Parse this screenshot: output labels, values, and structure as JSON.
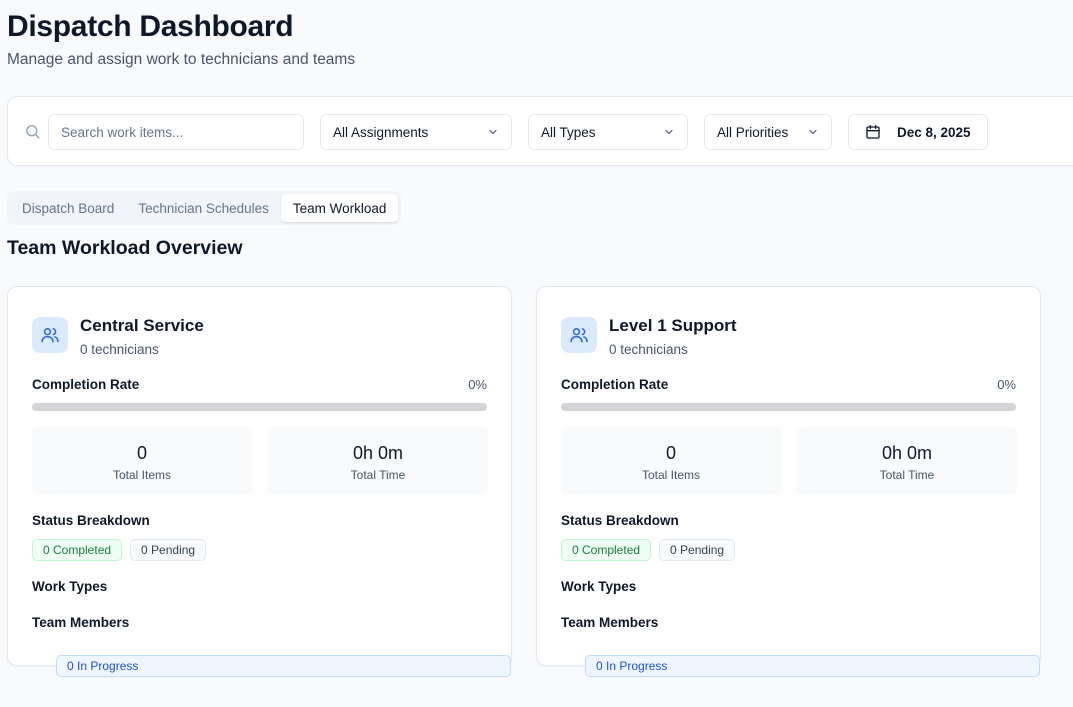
{
  "header": {
    "title": "Dispatch Dashboard",
    "subtitle": "Manage and assign work to technicians and teams"
  },
  "filters": {
    "search_placeholder": "Search work items...",
    "assignment": "All Assignments",
    "type": "All Types",
    "priority": "All Priorities",
    "date": "Dec 8, 2025"
  },
  "tabs": [
    {
      "label": "Dispatch Board",
      "active": false
    },
    {
      "label": "Technician Schedules",
      "active": false
    },
    {
      "label": "Team Workload",
      "active": true
    }
  ],
  "section_title": "Team Workload Overview",
  "labels": {
    "completion_rate": "Completion Rate",
    "total_items": "Total Items",
    "total_time": "Total Time",
    "status_breakdown": "Status Breakdown",
    "work_types": "Work Types",
    "team_members": "Team Members"
  },
  "teams": [
    {
      "name": "Central Service",
      "technicians": "0 technicians",
      "completion_rate": "0%",
      "completion_fraction": 0,
      "total_items": "0",
      "total_time": "0h 0m",
      "completed": "0 Completed",
      "in_progress": "0 In Progress",
      "pending": "0 Pending"
    },
    {
      "name": "Level 1 Support",
      "technicians": "0 technicians",
      "completion_rate": "0%",
      "completion_fraction": 0,
      "total_items": "0",
      "total_time": "0h 0m",
      "completed": "0 Completed",
      "in_progress": "0 In Progress",
      "pending": "0 Pending"
    }
  ],
  "colors": {
    "accent": "#2563eb",
    "icon_bg": "#dbeafe",
    "completed": "#15803d",
    "in_progress": "#1d4ed8"
  },
  "icons": {
    "search": "search-icon",
    "chevron": "chevron-down-icon",
    "calendar": "calendar-icon",
    "team": "users-icon"
  }
}
